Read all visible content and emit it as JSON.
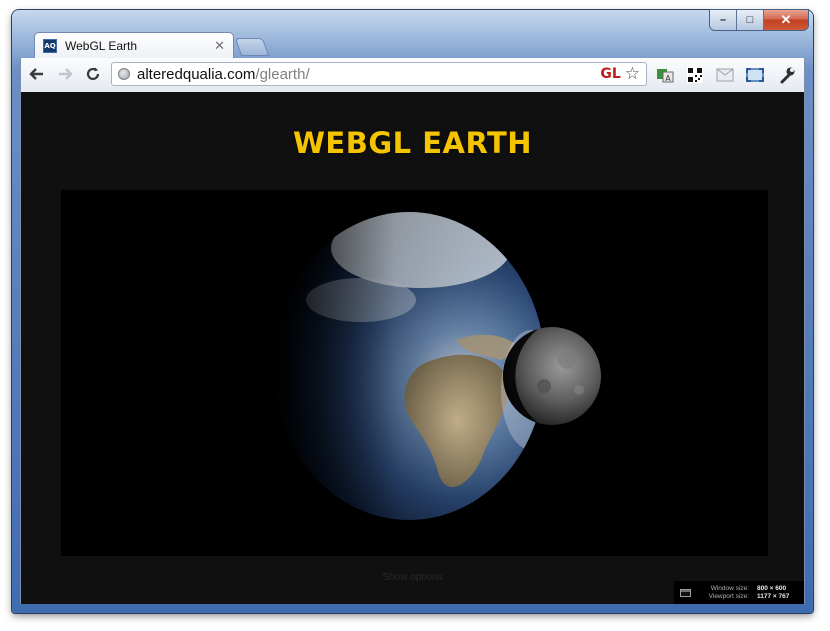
{
  "browser": {
    "tab_title": "WebGL Earth",
    "tab_favicon_text": "AQ",
    "url_host": "alteredqualia.com",
    "url_path": "/glearth/",
    "gl_badge": "GL",
    "window_controls": [
      "minimize",
      "maximize",
      "close"
    ],
    "icons": [
      "back-icon",
      "forward-icon",
      "reload-icon",
      "globe-icon",
      "star-icon",
      "translate-icon",
      "qr-code-icon",
      "mail-icon",
      "fullscreen-icon",
      "wrench-icon"
    ]
  },
  "page": {
    "title": "WEBGL EARTH",
    "show_options": "Show options",
    "window_size_label": "Window size:",
    "window_size_value": "800 × 600",
    "viewport_size_label": "Viewport size:",
    "viewport_size_value": "1177 × 767"
  },
  "colors": {
    "title": "#f5c400",
    "page_bg": "#101010",
    "canvas_bg": "#000000",
    "gl_badge": "#c11a1a"
  }
}
